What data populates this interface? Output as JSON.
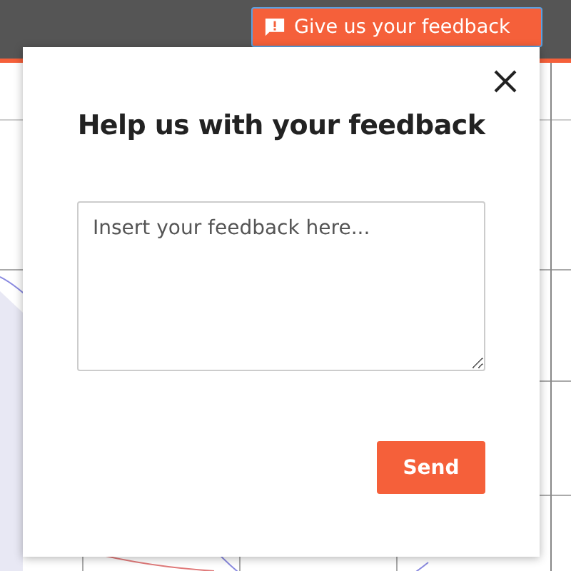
{
  "top_bar": {
    "feedback_button": {
      "label": "Give us your feedback"
    }
  },
  "dialog": {
    "title": "Help us with your feedback",
    "feedback_field": {
      "placeholder": "Insert your feedback here..."
    },
    "send_button": {
      "label": "Send"
    }
  }
}
